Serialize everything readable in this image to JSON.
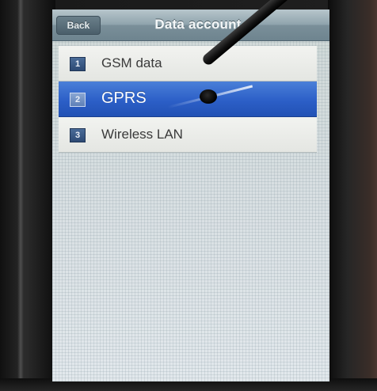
{
  "navbar": {
    "back_label": "Back",
    "title": "Data account"
  },
  "list": {
    "items": [
      {
        "number": "1",
        "label": "GSM data",
        "selected": false
      },
      {
        "number": "2",
        "label": "GPRS",
        "selected": true
      },
      {
        "number": "3",
        "label": "Wireless LAN",
        "selected": false
      }
    ]
  },
  "colors": {
    "selected_row": "#2c5fc7",
    "navbar": "#8499a3",
    "list_background": "#d6dde0"
  }
}
